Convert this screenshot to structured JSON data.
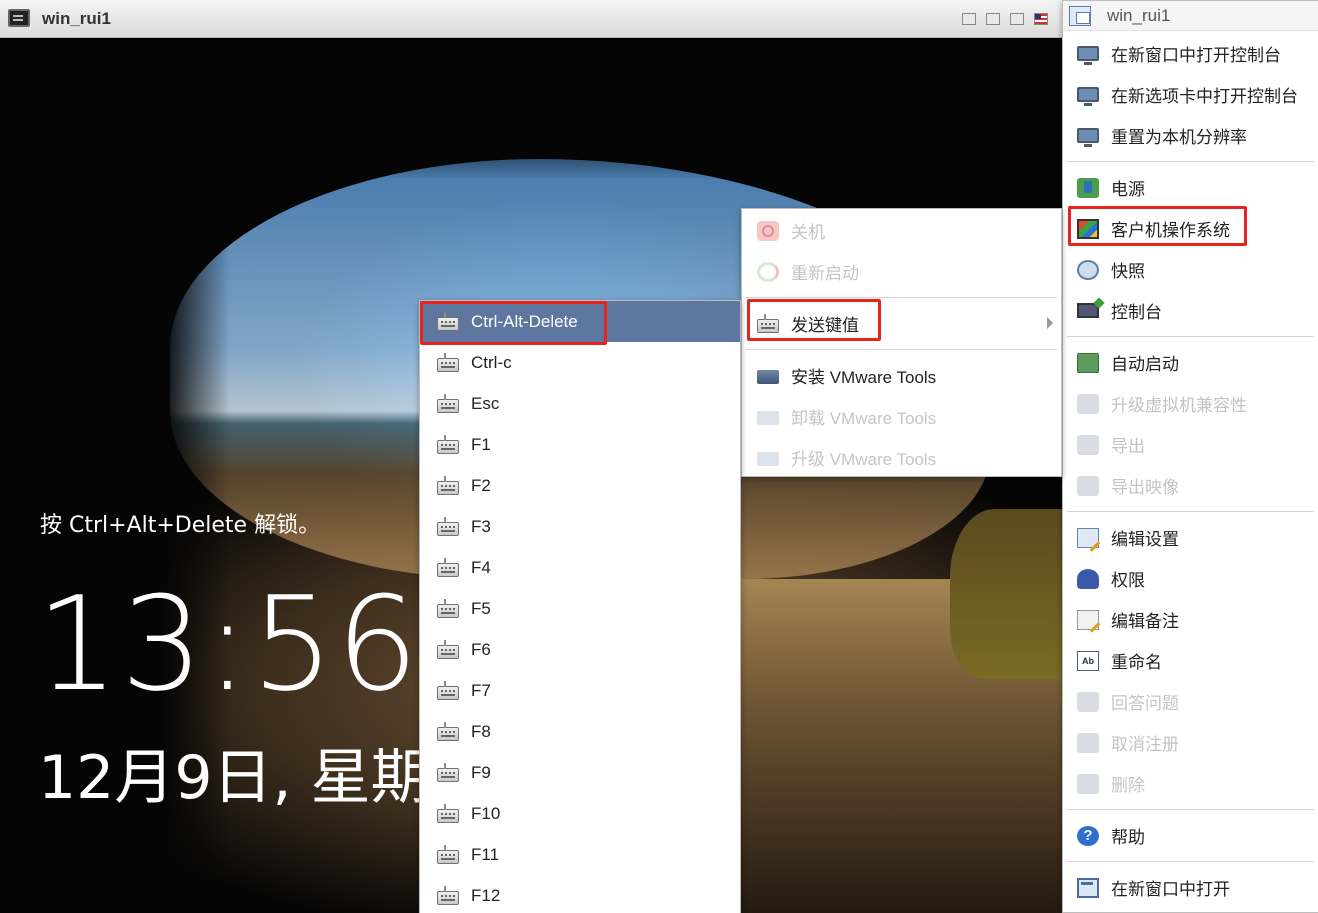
{
  "console_window": {
    "title": "win_rui1",
    "icon": "console-screen-icon",
    "controls": [
      "minimize-icon",
      "restore-icon",
      "fullscreen-icon",
      "keyboard-layout-flag-icon"
    ]
  },
  "lock_screen": {
    "hint": "按 Ctrl+Alt+Delete 解锁。",
    "time": "13:56",
    "date": "12月9日, 星期"
  },
  "main_menu": {
    "header": "win_rui1",
    "items": [
      {
        "label": "在新窗口中打开控制台",
        "icon": "monitor-icon",
        "enabled": true
      },
      {
        "label": "在新选项卡中打开控制台",
        "icon": "monitor-icon",
        "enabled": true
      },
      {
        "label": "重置为本机分辨率",
        "icon": "monitor-icon",
        "enabled": true
      },
      {
        "label": "电源",
        "icon": "power-icon",
        "enabled": true
      },
      {
        "label": "客户机操作系统",
        "icon": "guest-os-icon",
        "enabled": true
      },
      {
        "label": "快照",
        "icon": "snapshot-icon",
        "enabled": true
      },
      {
        "label": "控制台",
        "icon": "console-icon",
        "enabled": true
      },
      {
        "label": "自动启动",
        "icon": "autostart-icon",
        "enabled": true
      },
      {
        "label": "升级虚拟机兼容性",
        "icon": "upgrade-compat-icon",
        "enabled": false
      },
      {
        "label": "导出",
        "icon": "export-icon",
        "enabled": false
      },
      {
        "label": "导出映像",
        "icon": "export-image-icon",
        "enabled": false
      },
      {
        "label": "编辑设置",
        "icon": "edit-settings-icon",
        "enabled": true
      },
      {
        "label": "权限",
        "icon": "permissions-icon",
        "enabled": true
      },
      {
        "label": "编辑备注",
        "icon": "edit-notes-icon",
        "enabled": true
      },
      {
        "label": "重命名",
        "icon": "rename-icon",
        "enabled": true
      },
      {
        "label": "回答问题",
        "icon": "answer-question-icon",
        "enabled": false
      },
      {
        "label": "取消注册",
        "icon": "unregister-icon",
        "enabled": false
      },
      {
        "label": "删除",
        "icon": "delete-icon",
        "enabled": false
      },
      {
        "label": "帮助",
        "icon": "help-icon",
        "enabled": true
      },
      {
        "label": "在新窗口中打开",
        "icon": "new-window-icon",
        "enabled": true
      }
    ]
  },
  "guest_menu": {
    "items": [
      {
        "label": "关机",
        "icon": "shutdown-icon",
        "enabled": false
      },
      {
        "label": "重新启动",
        "icon": "restart-icon",
        "enabled": false
      },
      {
        "label": "发送键值",
        "icon": "keyboard-icon",
        "enabled": true,
        "submenu": true
      },
      {
        "label": "安装 VMware Tools",
        "icon": "install-tools-icon",
        "enabled": true
      },
      {
        "label": "卸载 VMware Tools",
        "icon": "uninstall-tools-icon",
        "enabled": false
      },
      {
        "label": "升级 VMware Tools",
        "icon": "upgrade-tools-icon",
        "enabled": false
      }
    ]
  },
  "keys_menu": {
    "selected": "Ctrl-Alt-Delete",
    "items": [
      "Ctrl-Alt-Delete",
      "Ctrl-c",
      "Esc",
      "F1",
      "F2",
      "F3",
      "F4",
      "F5",
      "F6",
      "F7",
      "F8",
      "F9",
      "F10",
      "F11",
      "F12"
    ]
  },
  "colors": {
    "highlight_border": "#e8231c",
    "selected_bg": "#5e77a1",
    "disabled_text": "#c4c4c4"
  }
}
